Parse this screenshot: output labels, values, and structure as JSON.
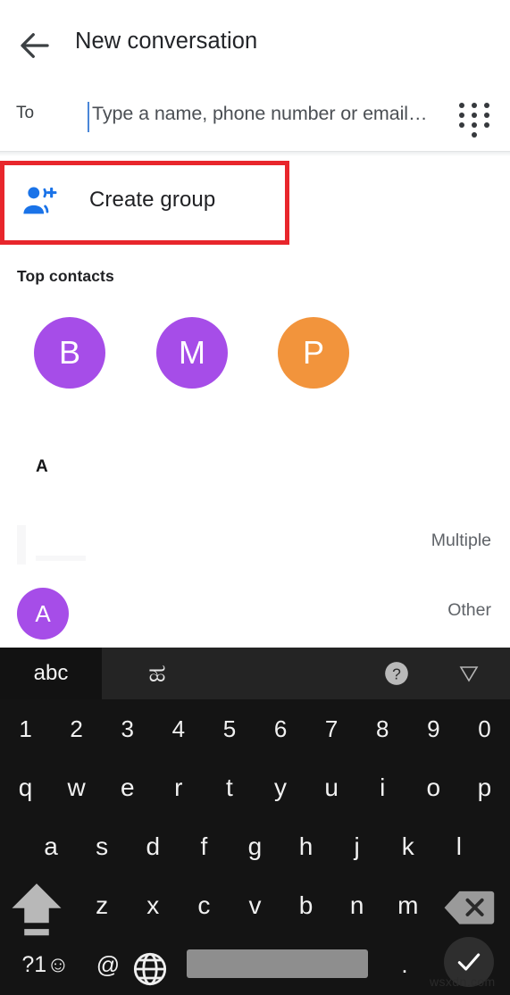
{
  "header": {
    "title": "New conversation",
    "back_icon": "arrow-back-icon"
  },
  "recipient_field": {
    "label": "To",
    "value": "",
    "placeholder": "Type a name, phone number or email…",
    "dialpad_icon": "dialpad-icon"
  },
  "create_group": {
    "label": "Create group",
    "icon": "person-add-icon",
    "icon_color": "#1a73e8",
    "highlight_color": "#e8262c"
  },
  "top_contacts": {
    "heading": "Top contacts",
    "avatars": [
      {
        "initial": "B",
        "color": "#a64de8"
      },
      {
        "initial": "M",
        "color": "#a64de8"
      },
      {
        "initial": "P",
        "color": "#f2943c"
      }
    ]
  },
  "contact_list": {
    "section_letter": "A",
    "rows": [
      {
        "initial": "",
        "color": "#ffffff",
        "subtype": "Multiple"
      },
      {
        "initial": "A",
        "color": "#a64de8",
        "subtype": "Other"
      }
    ]
  },
  "keyboard": {
    "toolbar": {
      "tab_latin": "abc",
      "tab_script": "ಹ",
      "help_icon": "help-circle-icon",
      "collapse_icon": "chevron-down-icon"
    },
    "rows": {
      "numbers": [
        "1",
        "2",
        "3",
        "4",
        "5",
        "6",
        "7",
        "8",
        "9",
        "0"
      ],
      "row1": [
        "q",
        "w",
        "e",
        "r",
        "t",
        "y",
        "u",
        "i",
        "o",
        "p"
      ],
      "row2": [
        "a",
        "s",
        "d",
        "f",
        "g",
        "h",
        "j",
        "k",
        "l"
      ],
      "row3": [
        "z",
        "x",
        "c",
        "v",
        "b",
        "n",
        "m"
      ]
    },
    "shift_icon": "shift-caps-icon",
    "backspace_icon": "backspace-icon",
    "symbols_key": "?1☺",
    "at_key": "@",
    "globe_icon": "globe-language-icon",
    "space_key": "",
    "period_key": ".",
    "enter_icon": "check-enter-icon"
  },
  "watermark": {
    "text": "wsxdn.com"
  }
}
